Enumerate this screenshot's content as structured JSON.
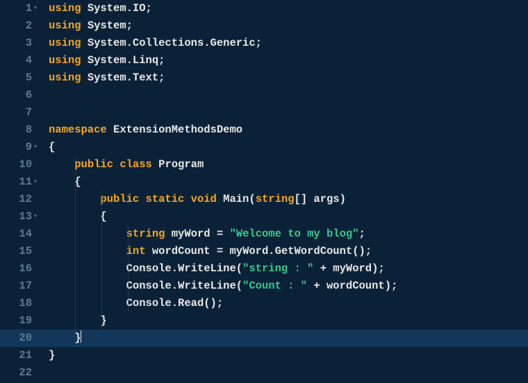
{
  "editor": {
    "lineCount": 22,
    "highlightedLine": 20,
    "foldMarkers": [
      1,
      9,
      11,
      13
    ],
    "lines": {
      "1": [
        {
          "t": "using ",
          "c": "kw"
        },
        {
          "t": "System.IO",
          "c": "ns"
        },
        {
          "t": ";",
          "c": "pn"
        }
      ],
      "2": [
        {
          "t": "using ",
          "c": "kw"
        },
        {
          "t": "System",
          "c": "ns"
        },
        {
          "t": ";",
          "c": "pn"
        }
      ],
      "3": [
        {
          "t": "using ",
          "c": "kw"
        },
        {
          "t": "System.Collections.Generic",
          "c": "ns"
        },
        {
          "t": ";",
          "c": "pn"
        }
      ],
      "4": [
        {
          "t": "using ",
          "c": "kw"
        },
        {
          "t": "System.Linq",
          "c": "ns"
        },
        {
          "t": ";",
          "c": "pn"
        }
      ],
      "5": [
        {
          "t": "using ",
          "c": "kw"
        },
        {
          "t": "System.Text",
          "c": "ns"
        },
        {
          "t": ";",
          "c": "pn"
        }
      ],
      "6": [],
      "7": [],
      "8": [
        {
          "t": "namespace ",
          "c": "kw"
        },
        {
          "t": "ExtensionMethodsDemo",
          "c": "ns"
        }
      ],
      "9": [
        {
          "t": "{",
          "c": "pn"
        }
      ],
      "10": [
        {
          "t": "    ",
          "c": ""
        },
        {
          "t": "public class ",
          "c": "kw"
        },
        {
          "t": "Program",
          "c": "cls"
        }
      ],
      "11": [
        {
          "t": "    ",
          "c": ""
        },
        {
          "t": "{",
          "c": "pn"
        }
      ],
      "12": [
        {
          "t": "        ",
          "c": ""
        },
        {
          "t": "public static void ",
          "c": "kw"
        },
        {
          "t": "Main",
          "c": "mtd"
        },
        {
          "t": "(",
          "c": "pn"
        },
        {
          "t": "string",
          "c": "type"
        },
        {
          "t": "[] args)",
          "c": "pn"
        }
      ],
      "13": [
        {
          "t": "        ",
          "c": ""
        },
        {
          "t": "{",
          "c": "pn"
        }
      ],
      "14": [
        {
          "t": "            ",
          "c": ""
        },
        {
          "t": "string ",
          "c": "type"
        },
        {
          "t": "myWord ",
          "c": ""
        },
        {
          "t": "= ",
          "c": "op"
        },
        {
          "t": "\"Welcome to my blog\"",
          "c": "str"
        },
        {
          "t": ";",
          "c": "pn"
        }
      ],
      "15": [
        {
          "t": "            ",
          "c": ""
        },
        {
          "t": "int ",
          "c": "type"
        },
        {
          "t": "wordCount ",
          "c": ""
        },
        {
          "t": "= ",
          "c": "op"
        },
        {
          "t": "myWord.GetWordCount();",
          "c": ""
        }
      ],
      "16": [
        {
          "t": "            ",
          "c": ""
        },
        {
          "t": "Console.WriteLine(",
          "c": ""
        },
        {
          "t": "\"string : \"",
          "c": "str"
        },
        {
          "t": " + myWord);",
          "c": ""
        }
      ],
      "17": [
        {
          "t": "            ",
          "c": ""
        },
        {
          "t": "Console.WriteLine(",
          "c": ""
        },
        {
          "t": "\"Count : \"",
          "c": "str"
        },
        {
          "t": " + wordCount);",
          "c": ""
        }
      ],
      "18": [
        {
          "t": "            ",
          "c": ""
        },
        {
          "t": "Console.Read();",
          "c": ""
        }
      ],
      "19": [
        {
          "t": "        ",
          "c": ""
        },
        {
          "t": "}",
          "c": "pn"
        }
      ],
      "20": [
        {
          "t": "    ",
          "c": ""
        },
        {
          "t": "}",
          "c": "pn"
        },
        {
          "t": "",
          "c": "cursor-here"
        }
      ],
      "21": [
        {
          "t": "}",
          "c": "pn"
        }
      ],
      "22": []
    },
    "indentGuides": {
      "10": [
        38
      ],
      "11": [
        38
      ],
      "12": [
        38,
        76
      ],
      "13": [
        38,
        76
      ],
      "14": [
        38,
        76,
        114
      ],
      "15": [
        38,
        76,
        114
      ],
      "16": [
        38,
        76,
        114
      ],
      "17": [
        38,
        76,
        114
      ],
      "18": [
        38,
        76,
        114
      ],
      "19": [
        38,
        76
      ],
      "20": [
        38
      ]
    }
  }
}
